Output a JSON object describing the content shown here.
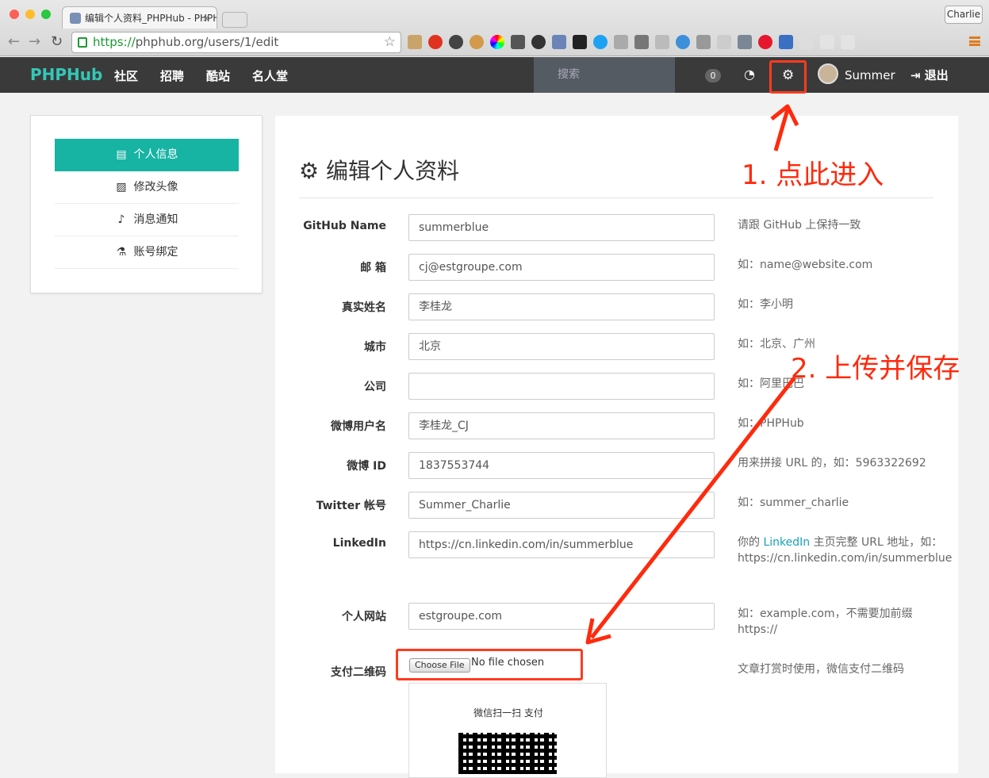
{
  "browser": {
    "tab_title": "编辑个人资料_PHPHub - PHPHub",
    "user_chip": "Charlie",
    "url_scheme": "https://",
    "url_rest": "phphub.org/users/1/edit"
  },
  "nav": {
    "brand": "PHPHub",
    "items": [
      "社区",
      "招聘",
      "酷站",
      "名人堂"
    ],
    "search_placeholder": "搜索",
    "notification_count": "0",
    "username": "Summer",
    "logout": "退出"
  },
  "sidebar": {
    "items": [
      {
        "label": "个人信息",
        "icon": "id-card-icon"
      },
      {
        "label": "修改头像",
        "icon": "image-icon"
      },
      {
        "label": "消息通知",
        "icon": "bell-icon"
      },
      {
        "label": "账号绑定",
        "icon": "flask-icon"
      }
    ]
  },
  "form": {
    "title": "编辑个人资料",
    "rows": [
      {
        "label": "GitHub Name",
        "value": "summerblue",
        "hint": "请跟 GitHub 上保持一致"
      },
      {
        "label": "邮 箱",
        "value": "cj@estgroupe.com",
        "hint": "如：name@website.com"
      },
      {
        "label": "真实姓名",
        "value": "李桂龙",
        "hint": "如：李小明"
      },
      {
        "label": "城市",
        "value": "北京",
        "hint": "如：北京、广州"
      },
      {
        "label": "公司",
        "value": "",
        "hint": "如：阿里巴巴"
      },
      {
        "label": "微博用户名",
        "value": "李桂龙_CJ",
        "hint": "如：PHPHub"
      },
      {
        "label": "微博 ID",
        "value": "1837553744",
        "hint": "用来拼接 URL 的，如：5963322692"
      },
      {
        "label": "Twitter 帐号",
        "value": "Summer_Charlie",
        "hint": "如：summer_charlie"
      },
      {
        "label": "LinkedIn",
        "value": "https://cn.linkedin.com/in/summerblue"
      },
      {
        "label": "个人网站",
        "value": "estgroupe.com",
        "hint": "如：example.com，不需要加前缀 https://"
      },
      {
        "label": "支付二维码",
        "hint": "文章打赏时使用，微信支付二维码"
      }
    ],
    "linkedin_hint": {
      "pre": "你的 ",
      "link": "LinkedIn",
      "post": " 主页完整 URL 地址，如：https://cn.linkedin.com/in/summerblue"
    },
    "file_button": "Choose File",
    "file_status": "No file chosen",
    "qr_caption": "微信扫一扫 支付"
  },
  "annotations": {
    "step1": "1. 点此进入",
    "step2": "2. 上传并保存",
    "color": "#ff2a0d"
  }
}
